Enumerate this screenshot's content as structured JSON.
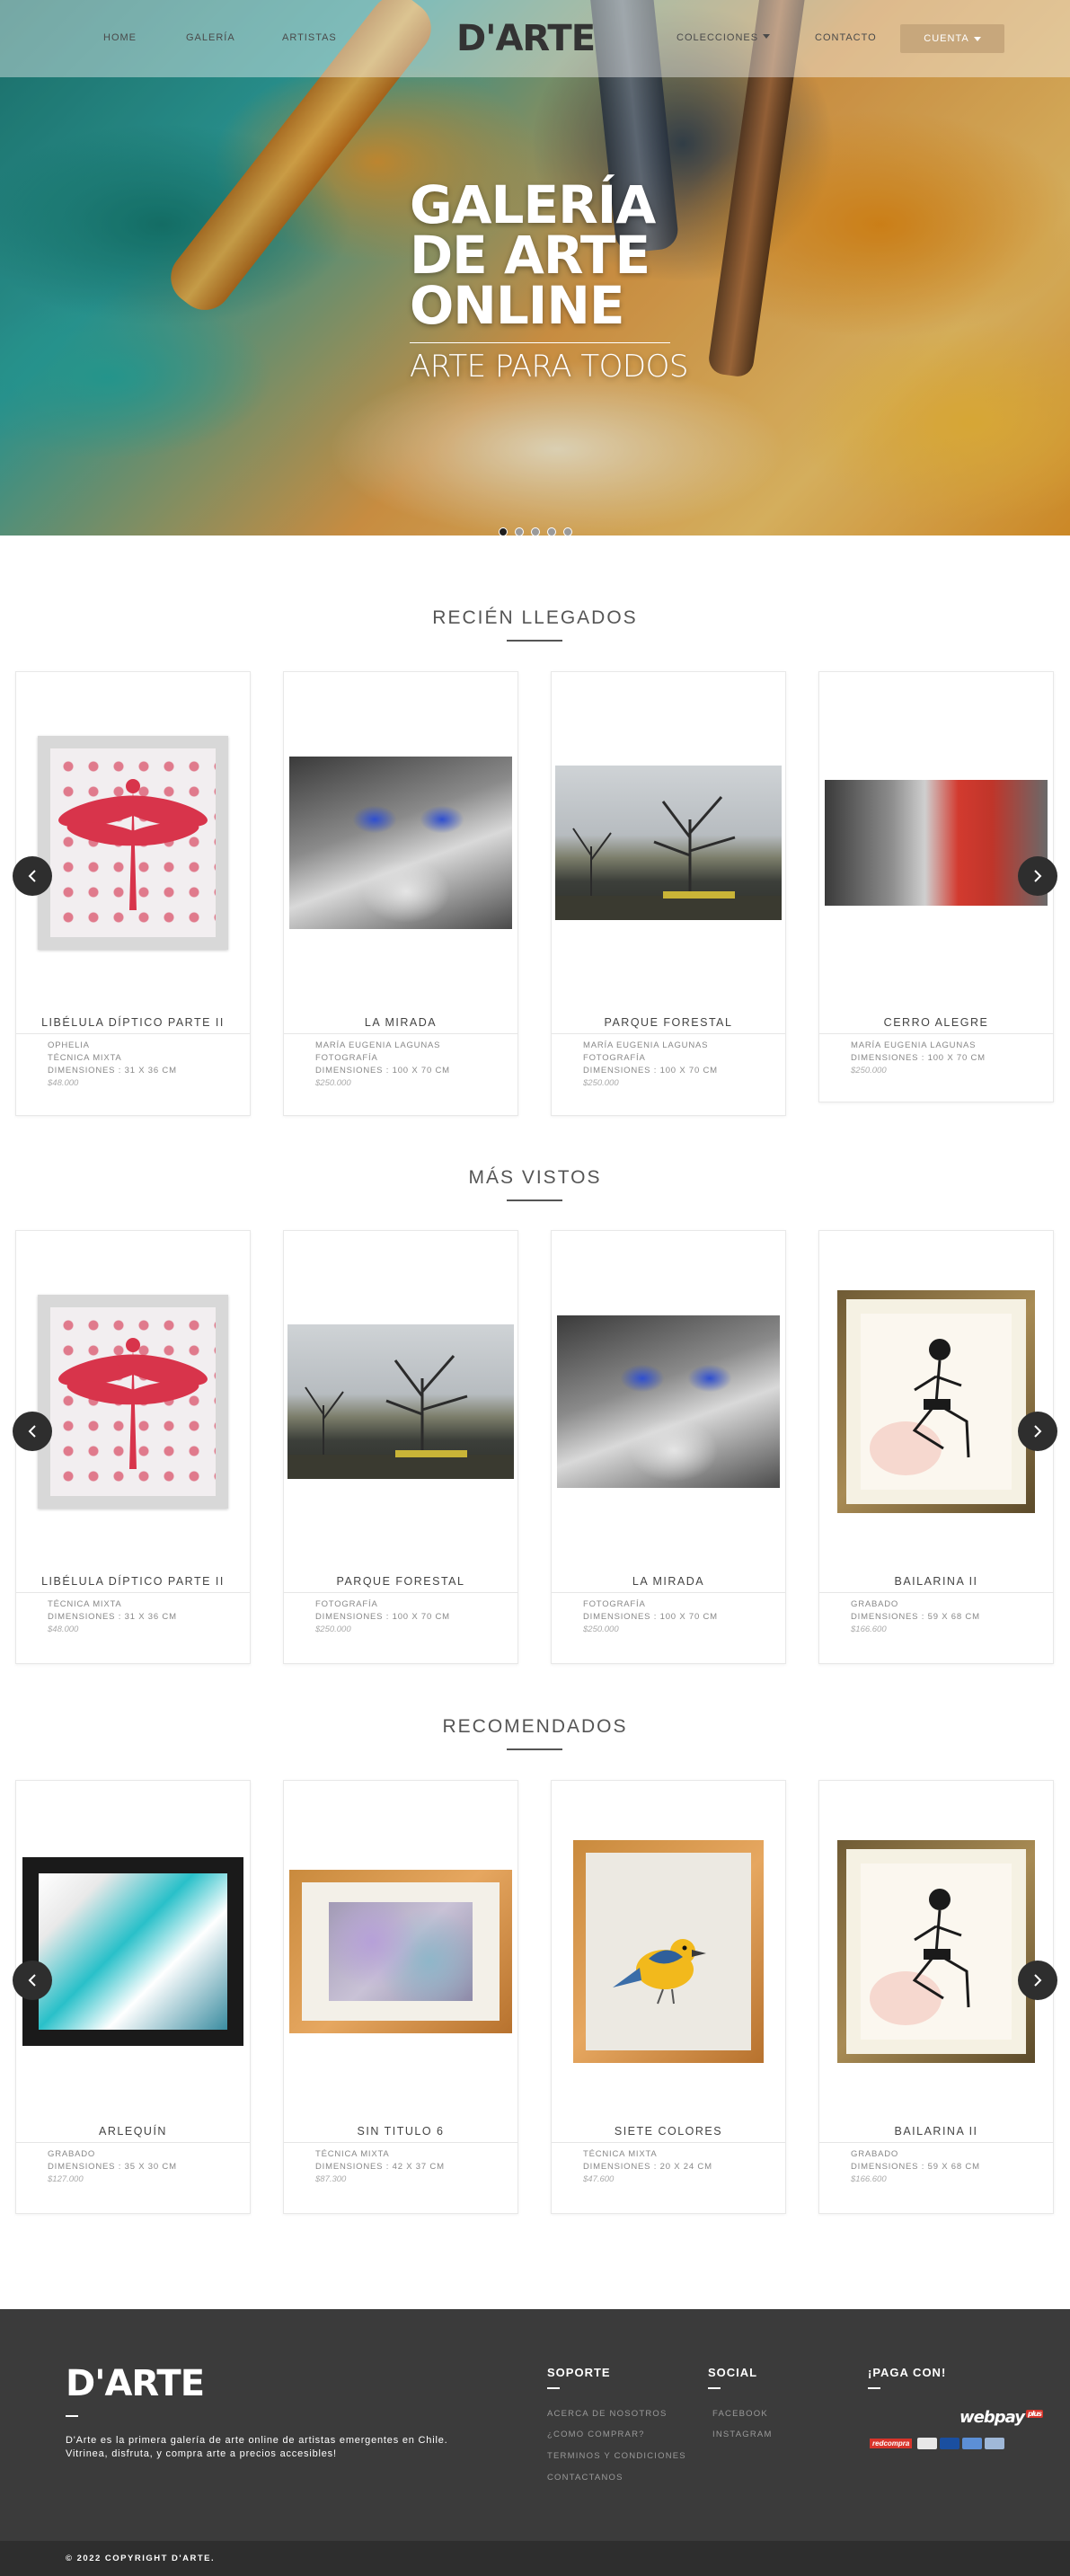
{
  "nav": {
    "home": "HOME",
    "galeria": "GALERÍA",
    "artistas": "ARTISTAS",
    "logo": "D'ARTE",
    "colecciones": "COLECCIONES",
    "contacto": "CONTACTO",
    "cuenta": "CUENTA"
  },
  "hero": {
    "title_lines": [
      "GALERÍA",
      "DE ARTE",
      "ONLINE"
    ],
    "subtitle": "ARTE PARA TODOS",
    "slide_count": 5,
    "active_slide": 1
  },
  "sections": [
    {
      "title": "RECIÉN LLEGADOS",
      "items": [
        {
          "title": "LIBÉLULA DÍPTICO PARTE II",
          "meta": [
            "OPHELIA",
            "TÉCNICA MIXTA",
            "DIMENSIONES : 31 X 36 CM"
          ],
          "price": "$48.000"
        },
        {
          "title": "LA MIRADA",
          "meta": [
            "MARÍA EUGENIA LAGUNAS",
            "FOTOGRAFÍA",
            "DIMENSIONES : 100 X 70 CM"
          ],
          "price": "$250.000"
        },
        {
          "title": "PARQUE FORESTAL",
          "meta": [
            "MARÍA EUGENIA LAGUNAS",
            "FOTOGRAFÍA",
            "DIMENSIONES : 100 X 70 CM"
          ],
          "price": "$250.000"
        },
        {
          "title": "CERRO ALEGRE",
          "meta": [
            "MARÍA EUGENIA LAGUNAS",
            "DIMENSIONES : 100 X 70 CM"
          ],
          "price": "$250.000"
        }
      ]
    },
    {
      "title": "MÁS VISTOS",
      "items": [
        {
          "title": "LIBÉLULA DÍPTICO PARTE II",
          "meta": [
            "TÉCNICA MIXTA",
            "DIMENSIONES : 31 X 36 CM"
          ],
          "price": "$48.000"
        },
        {
          "title": "PARQUE FORESTAL",
          "meta": [
            "FOTOGRAFÍA",
            "DIMENSIONES : 100 X 70 CM"
          ],
          "price": "$250.000"
        },
        {
          "title": "LA MIRADA",
          "meta": [
            "FOTOGRAFÍA",
            "DIMENSIONES : 100 X 70 CM"
          ],
          "price": "$250.000"
        },
        {
          "title": "BAILARINA II",
          "meta": [
            "GRABADO",
            "DIMENSIONES : 59 X 68 CM"
          ],
          "price": "$166.600"
        }
      ]
    },
    {
      "title": "RECOMENDADOS",
      "items": [
        {
          "title": "ARLEQUÍN",
          "meta": [
            "GRABADO",
            "DIMENSIONES : 35 X 30 CM"
          ],
          "price": "$127.000"
        },
        {
          "title": "SIN TITULO 6",
          "meta": [
            "TÉCNICA MIXTA",
            "DIMENSIONES : 42 X 37 CM"
          ],
          "price": "$87.300"
        },
        {
          "title": "SIETE COLORES",
          "meta": [
            "TÉCNICA MIXTA",
            "DIMENSIONES : 20 X 24 CM"
          ],
          "price": "$47.600"
        },
        {
          "title": "BAILARINA II",
          "meta": [
            "GRABADO",
            "DIMENSIONES : 59 X 68 CM"
          ],
          "price": "$166.600"
        }
      ]
    }
  ],
  "footer": {
    "logo": "D'ARTE",
    "description": "D'Arte es la primera galería de arte online de artistas emergentes en Chile. Vitrinea, disfruta, y compra arte a precios accesibles!",
    "soporte": {
      "title": "SOPORTE",
      "links": [
        "ACERCA DE NOSOTROS",
        "¿COMO COMPRAR?",
        "TERMINOS Y CONDICIONES",
        "CONTACTANOS"
      ]
    },
    "social": {
      "title": "SOCIAL",
      "links": [
        "FACEBOOK",
        "INSTAGRAM"
      ]
    },
    "paga": {
      "title": "¡PAGA CON!",
      "webpay": "webpay",
      "webpay_plus": "plus",
      "redcompra": "redcompra"
    },
    "copyright": "© 2022 COPYRIGHT D'ARTE."
  },
  "colors": {
    "accent": "#c7a77c",
    "footer_bg": "#3b3b3b",
    "arrow_bg": "#2e2e2e"
  }
}
